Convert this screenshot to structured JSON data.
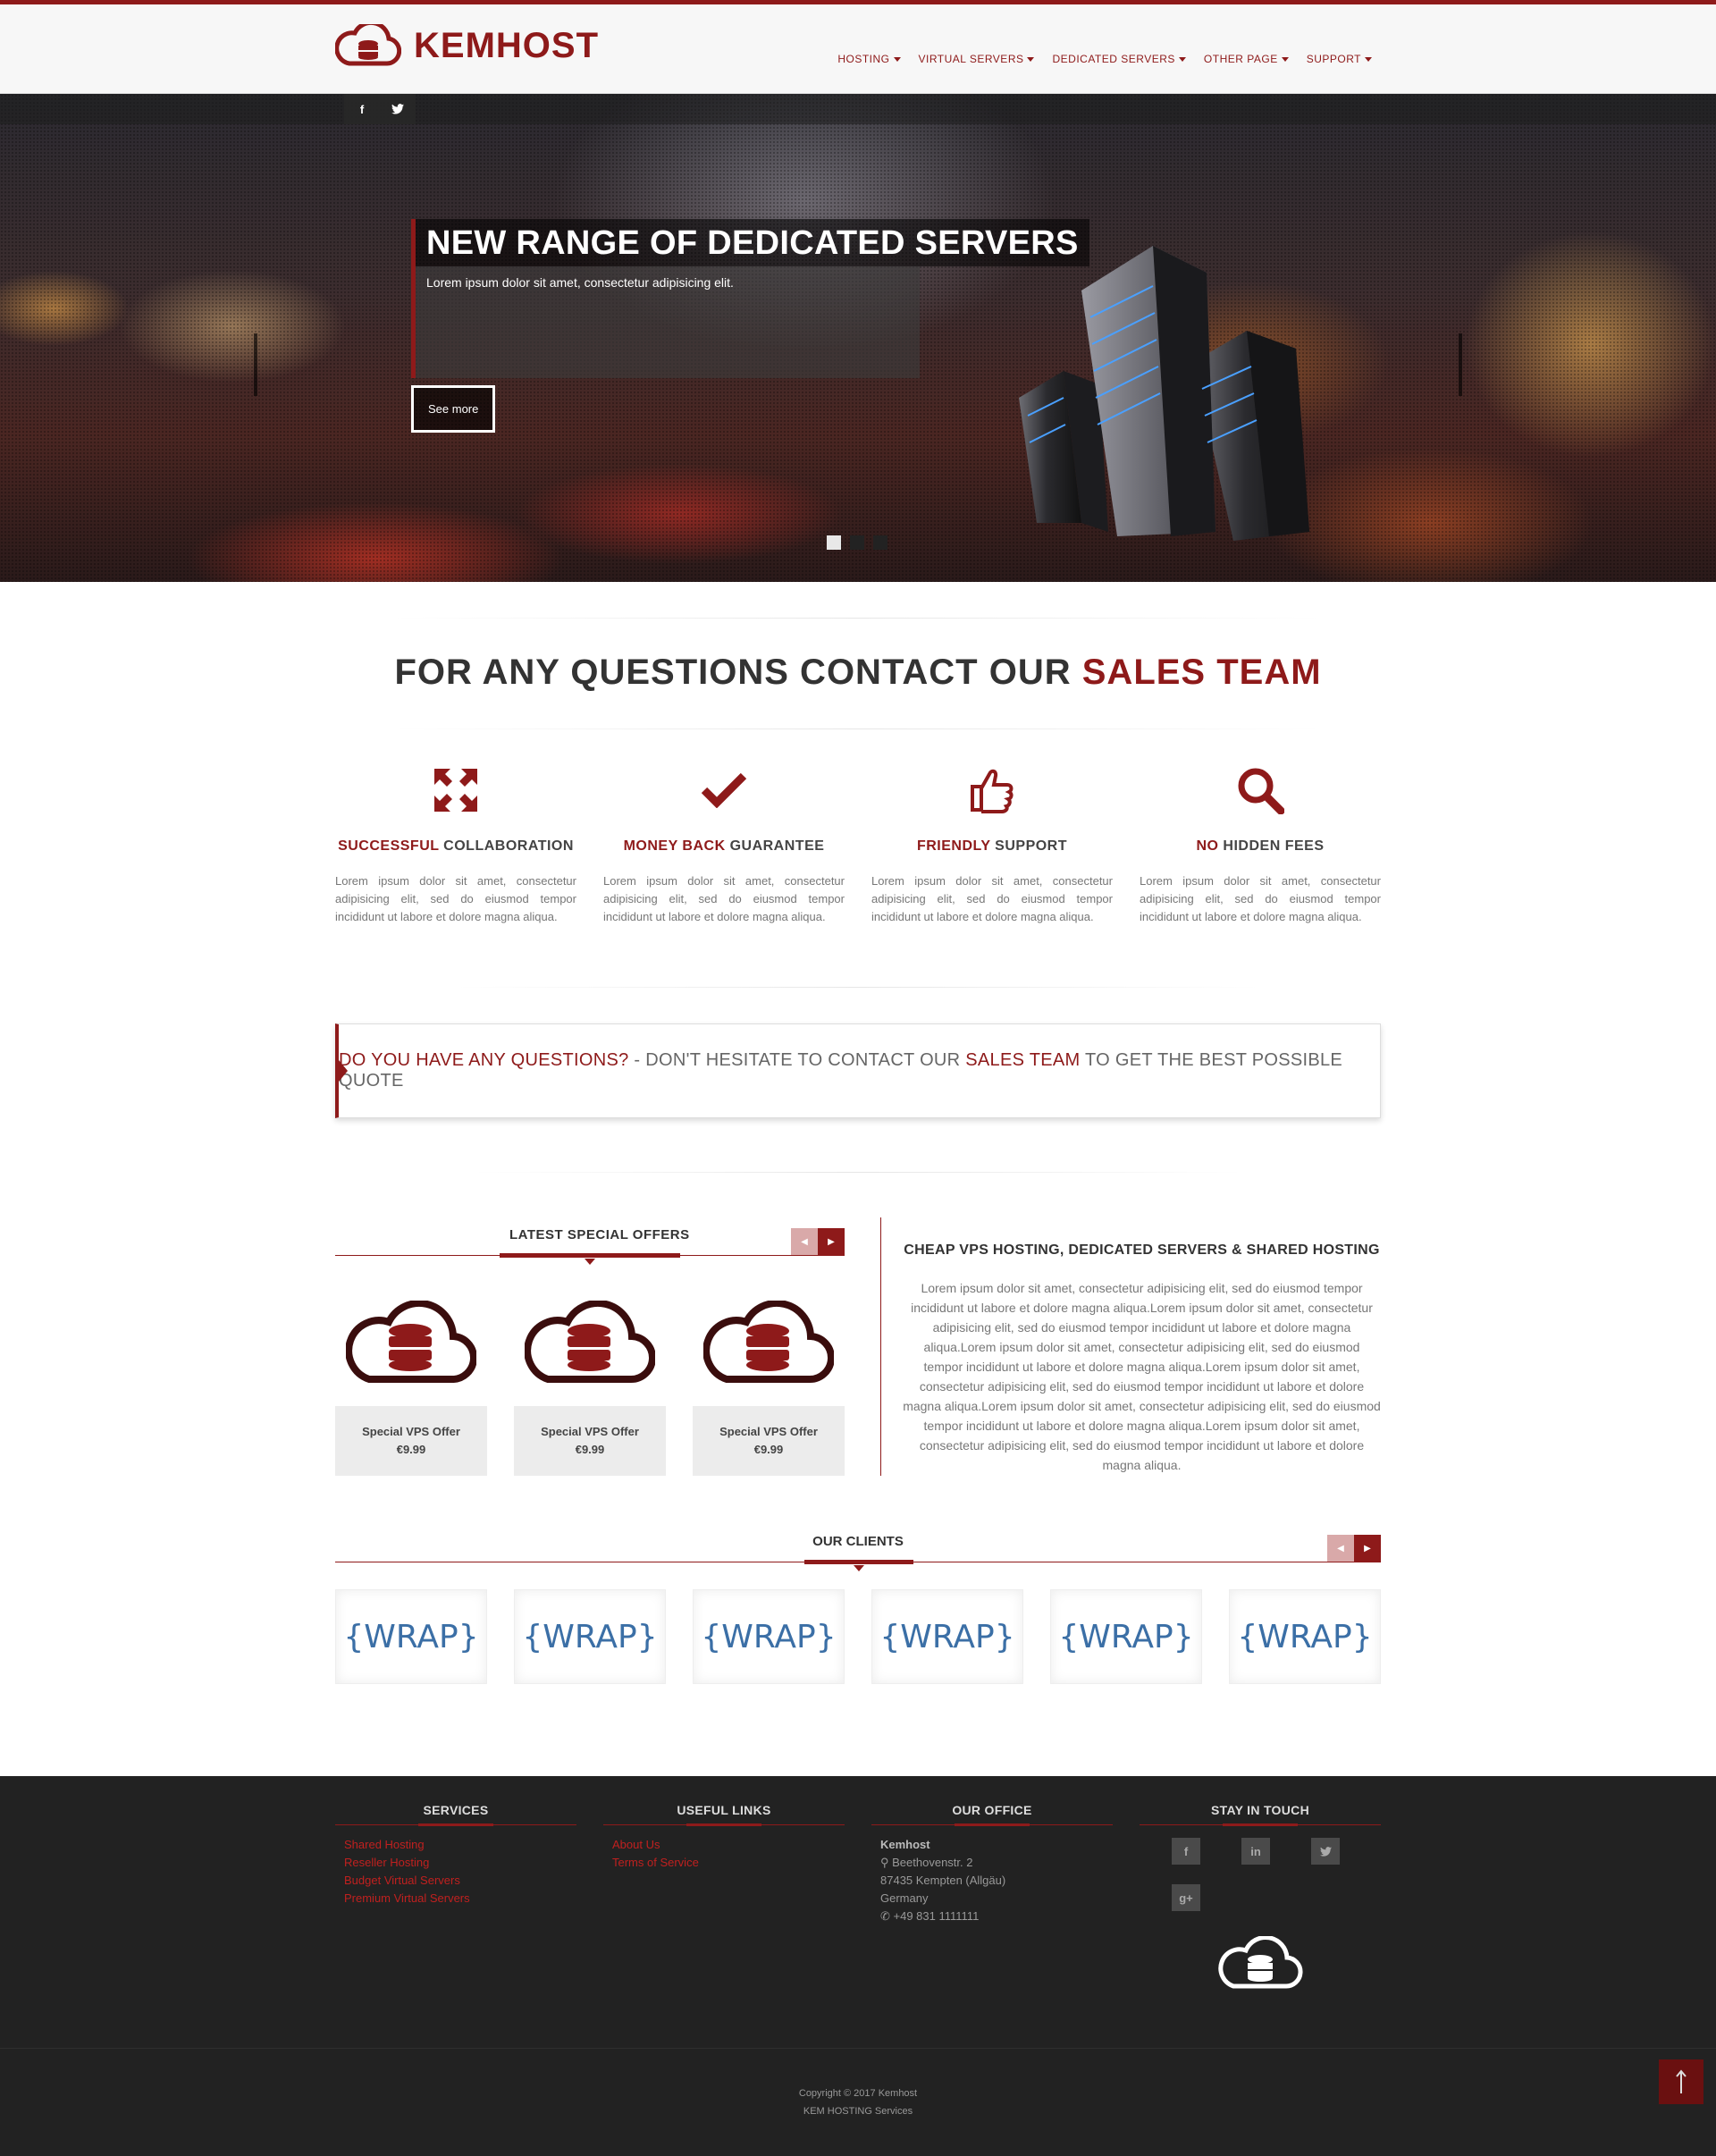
{
  "brand": {
    "name": "KEMHOST",
    "accent": "#8e1a1a"
  },
  "nav": {
    "items": [
      {
        "label": "HOSTING"
      },
      {
        "label": "VIRTUAL SERVERS"
      },
      {
        "label": "DEDICATED SERVERS"
      },
      {
        "label": "OTHER PAGE"
      },
      {
        "label": "SUPPORT"
      }
    ]
  },
  "social_top": {
    "facebook": "f",
    "twitter": "t"
  },
  "hero": {
    "title": "NEW RANGE OF DEDICATED SERVERS",
    "description": "Lorem ipsum dolor sit amet, consectetur adipisicing elit.",
    "button": "See more",
    "slide_count": 3,
    "active_slide": 1
  },
  "cta": {
    "prefix": "FOR ANY QUESTIONS CONTACT OUR",
    "accent": "SALES TEAM"
  },
  "features": [
    {
      "icon": "arrows-expand-icon",
      "title_red": "SUCCESSFUL",
      "title_rest": " COLLABORATION",
      "text": "Lorem ipsum dolor sit amet, consectetur adipisicing elit, sed do eiusmod tempor incididunt ut labore et dolore magna aliqua."
    },
    {
      "icon": "check-icon",
      "title_red": "MONEY BACK",
      "title_rest": " GUARANTEE",
      "text": "Lorem ipsum dolor sit amet, consectetur adipisicing elit, sed do eiusmod tempor incididunt ut labore et dolore magna aliqua."
    },
    {
      "icon": "thumbs-up-icon",
      "title_red": "FRIENDLY",
      "title_rest": " SUPPORT",
      "text": "Lorem ipsum dolor sit amet, consectetur adipisicing elit, sed do eiusmod tempor incididunt ut labore et dolore magna aliqua."
    },
    {
      "icon": "search-icon",
      "title_red": "NO",
      "title_rest": " HIDDEN FEES",
      "text": "Lorem ipsum dolor sit amet, consectetur adipisicing elit, sed do eiusmod tempor incididunt ut labore et dolore magna aliqua."
    }
  ],
  "callout": {
    "part1": "DO YOU HAVE ANY QUESTIONS?",
    "part2": " - DON'T HESITATE TO CONTACT OUR ",
    "part3": "SALES TEAM",
    "part4": " TO GET THE BEST POSSIBLE QUOTE"
  },
  "offers": {
    "heading": "LATEST SPECIAL OFFERS",
    "items": [
      {
        "name": "Special VPS Offer",
        "price": "€9.99"
      },
      {
        "name": "Special VPS Offer",
        "price": "€9.99"
      },
      {
        "name": "Special VPS Offer",
        "price": "€9.99"
      }
    ]
  },
  "about": {
    "heading": "CHEAP VPS HOSTING, DEDICATED SERVERS & SHARED HOSTING",
    "text": "Lorem ipsum dolor sit amet, consectetur adipisicing elit, sed do eiusmod tempor incididunt ut labore et dolore magna aliqua.Lorem ipsum dolor sit amet, consectetur adipisicing elit, sed do eiusmod tempor incididunt ut labore et dolore magna aliqua.Lorem ipsum dolor sit amet, consectetur adipisicing elit, sed do eiusmod tempor incididunt ut labore et dolore magna aliqua.Lorem ipsum dolor sit amet, consectetur adipisicing elit, sed do eiusmod tempor incididunt ut labore et dolore magna aliqua.Lorem ipsum dolor sit amet, consectetur adipisicing elit, sed do eiusmod tempor incididunt ut labore et dolore magna aliqua.Lorem ipsum dolor sit amet, consectetur adipisicing elit, sed do eiusmod tempor incididunt ut labore et dolore magna aliqua."
  },
  "clients": {
    "heading": "OUR CLIENTS",
    "items": [
      "{WRAP}",
      "{WRAP}",
      "{WRAP}",
      "{WRAP}",
      "{WRAP}",
      "{WRAP}"
    ]
  },
  "footer": {
    "services": {
      "heading": "SERVICES",
      "links": [
        "Shared Hosting",
        "Reseller Hosting",
        "Budget Virtual Servers",
        "Premium Virtual Servers"
      ]
    },
    "useful": {
      "heading": "USEFUL LINKS",
      "links": [
        "About Us",
        "Terms of Service"
      ]
    },
    "office": {
      "heading": "OUR OFFICE",
      "name": "Kemhost",
      "street": "Beethovenstr. 2",
      "city": "87435 Kempten (Allgäu)",
      "country": "Germany",
      "phone": "+49 831 1111111"
    },
    "touch": {
      "heading": "STAY IN TOUCH",
      "icons": [
        "f",
        "in",
        "t",
        "g+"
      ]
    },
    "copyright": "Copyright © 2017 Kemhost",
    "tagline": "KEM HOSTING Services"
  }
}
